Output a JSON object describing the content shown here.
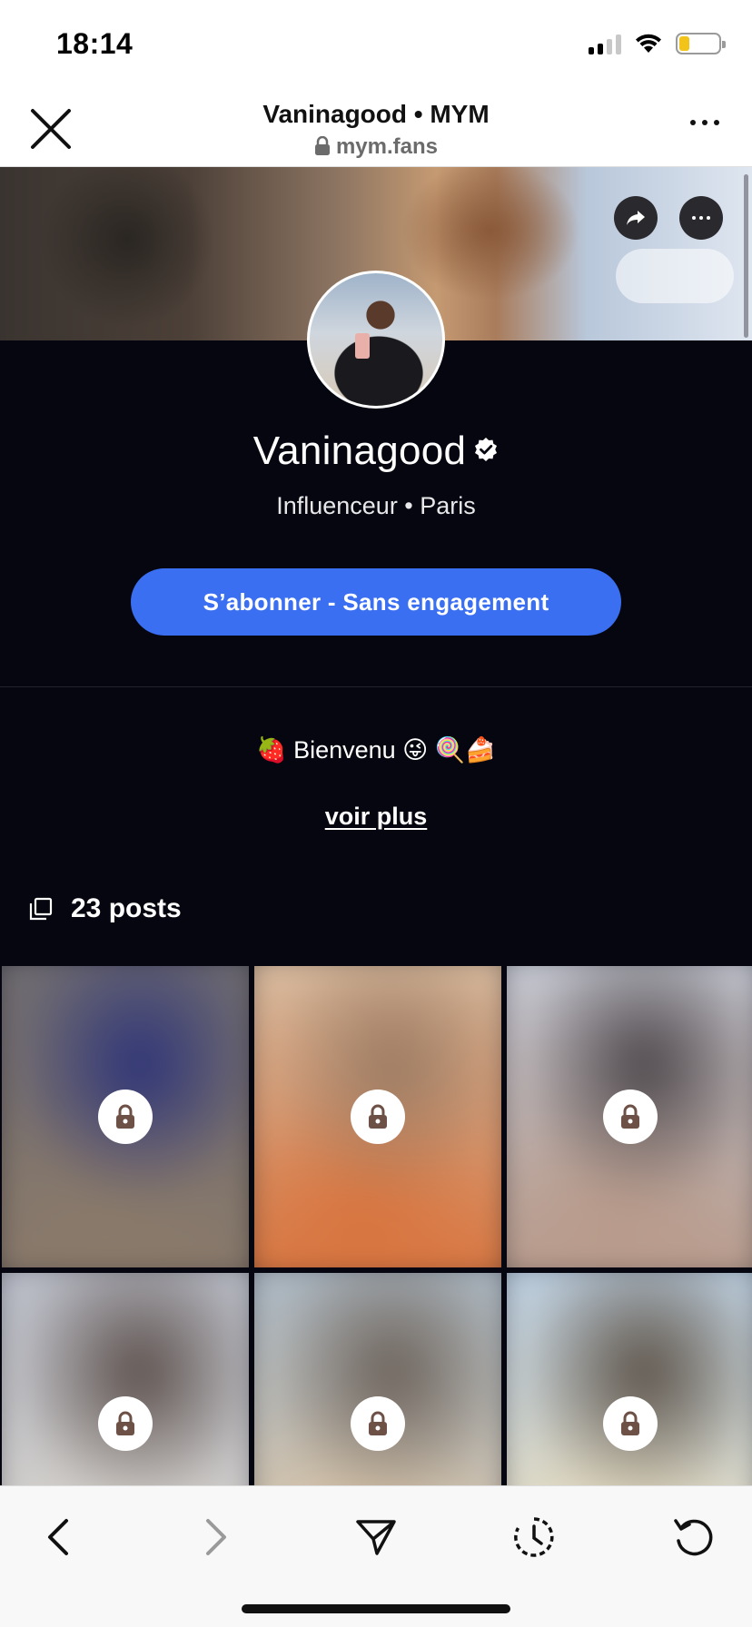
{
  "status_bar": {
    "time": "18:14"
  },
  "browser": {
    "title": "Vaninagood • MYM",
    "url": "mym.fans"
  },
  "profile": {
    "name": "Vaninagood",
    "verified": true,
    "subtitle": "Influenceur • Paris",
    "subscribe_label": "S’abonner - Sans engagement",
    "bio": "🍓 Bienvenu 😜 🍭🍰",
    "voir_plus_label": "voir plus",
    "posts_count_label": "23 posts"
  },
  "posts": [
    {
      "locked": true,
      "colors": [
        "#6c6a72",
        "#2d3378",
        "#8a7a6a"
      ]
    },
    {
      "locked": true,
      "colors": [
        "#d8c0a6",
        "#9a7a62",
        "#d8743e"
      ]
    },
    {
      "locked": true,
      "colors": [
        "#c5cad6",
        "#4a4448",
        "#b89a8a"
      ]
    },
    {
      "locked": true,
      "colors": [
        "#b8bcc8",
        "#5a4e4a",
        "#d6d2cc"
      ]
    },
    {
      "locked": true,
      "colors": [
        "#a9b8c6",
        "#6a6058",
        "#d8c4a8"
      ]
    },
    {
      "locked": true,
      "colors": [
        "#b8cce0",
        "#5a5046",
        "#e6dcc0"
      ]
    }
  ],
  "colors": {
    "accent": "#3a6ff2",
    "background": "#05060f"
  }
}
